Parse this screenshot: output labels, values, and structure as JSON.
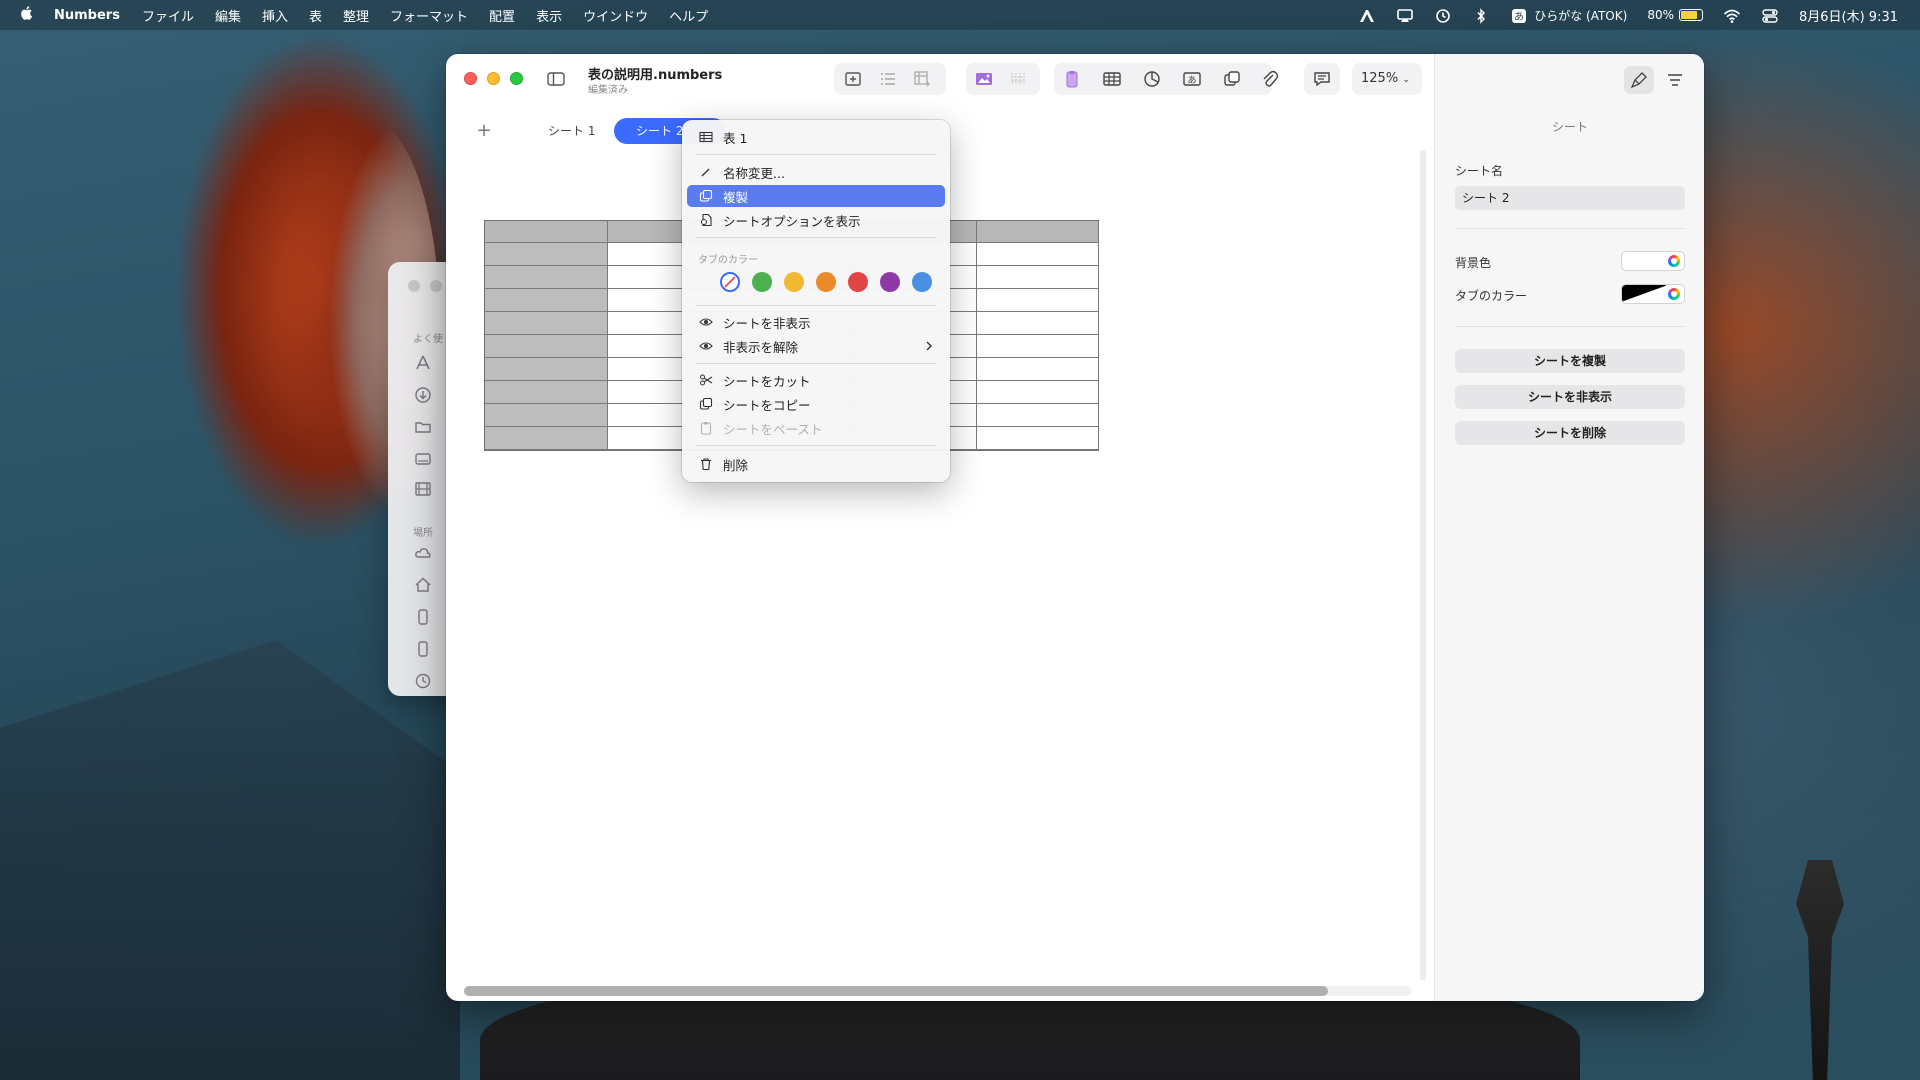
{
  "menubar": {
    "app_name": "Numbers",
    "menus": [
      "ファイル",
      "編集",
      "挿入",
      "表",
      "整理",
      "フォーマット",
      "配置",
      "表示",
      "ウインドウ",
      "ヘルプ"
    ],
    "input_method": "ひらがな (ATOK)",
    "battery_percent": "80%",
    "battery_level": 0.8,
    "datetime": "8月6日(木) 9:31"
  },
  "finder": {
    "section_favorites": "よく使",
    "section_places": "場所"
  },
  "window": {
    "doc_title": "表の説明用.numbers",
    "doc_status": "編集済み",
    "zoom": "125%",
    "tabs": [
      {
        "label": "シート 1",
        "active": false
      },
      {
        "label": "シート 2",
        "active": true
      }
    ]
  },
  "context_menu": {
    "items": [
      {
        "label": "表 1",
        "icon": "table-icon"
      },
      {
        "label": "名称変更...",
        "icon": "pencil-icon"
      },
      {
        "label": "複製",
        "icon": "duplicate-icon",
        "highlighted": true
      },
      {
        "label": "シートオプションを表示",
        "icon": "options-icon"
      },
      {
        "label": "シートを非表示",
        "icon": "eye-icon"
      },
      {
        "label": "非表示を解除",
        "icon": "eye-icon",
        "submenu": true
      },
      {
        "label": "シートをカット",
        "icon": "scissors-icon"
      },
      {
        "label": "シートをコピー",
        "icon": "copy-icon"
      },
      {
        "label": "シートをペースト",
        "icon": "paste-icon",
        "disabled": true
      },
      {
        "label": "削除",
        "icon": "trash-icon"
      }
    ],
    "tab_color_label": "タブのカラー",
    "tab_colors": [
      "none",
      "#4caf50",
      "#f0b92f",
      "#ec8a2a",
      "#e24444",
      "#8e3aa6",
      "#4a90e2"
    ]
  },
  "inspector": {
    "title": "シート",
    "sheet_name_label": "シート名",
    "sheet_name_value": "シート 2",
    "background_label": "背景色",
    "tab_color_label": "タブのカラー",
    "buttons": [
      "シートを複製",
      "シートを非表示",
      "シートを削除"
    ]
  }
}
